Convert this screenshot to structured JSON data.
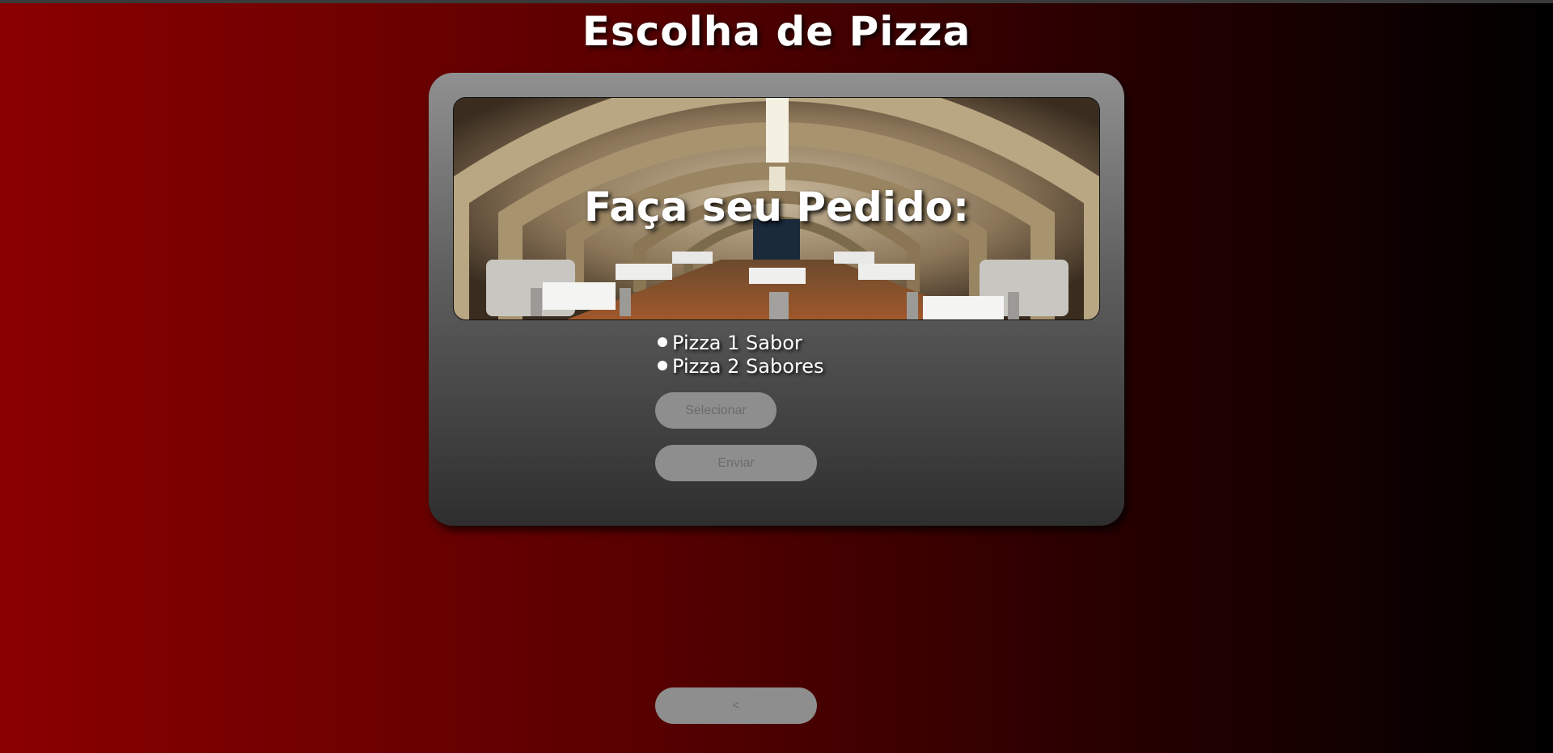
{
  "header": {
    "title": "Escolha de Pizza"
  },
  "panel": {
    "banner_heading": "Faça seu Pedido:",
    "options": [
      {
        "label": "Pizza 1 Sabor"
      },
      {
        "label": "Pizza 2 Sabores"
      }
    ],
    "select_button_label": "Selecionar",
    "send_button_label": "Enviar"
  },
  "footer": {
    "back_button_label": "<"
  },
  "colors": {
    "background_start": "#8b0000",
    "background_end": "#000000",
    "button_bg": "#8e8e8e",
    "button_text": "#6c6c6c",
    "text": "#ffffff"
  }
}
